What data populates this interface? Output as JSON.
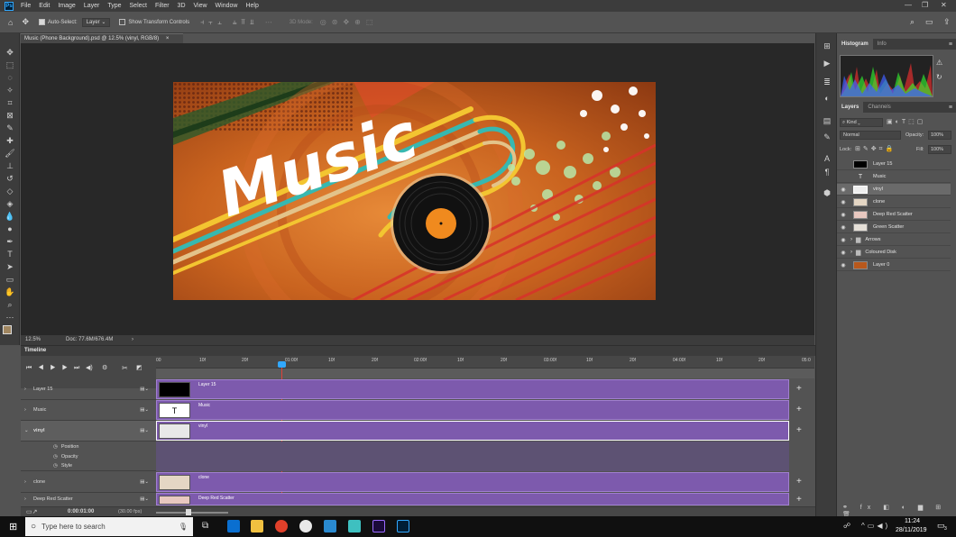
{
  "menubar": {
    "logo": "Ps",
    "items": [
      "File",
      "Edit",
      "Image",
      "Layer",
      "Type",
      "Select",
      "Filter",
      "3D",
      "View",
      "Window",
      "Help"
    ],
    "minimize": "—",
    "restore": "❐",
    "close": "✕"
  },
  "options": {
    "auto_select_label": "Auto-Select:",
    "auto_select_value": "Layer",
    "show_transform_label": "Show Transform Controls",
    "mode_3d": "3D Mode:"
  },
  "document": {
    "tab_title": "Music (Phone Background).psd @ 12.5% (vinyl, RGB/8)",
    "tab_close": "×",
    "art_title": "Music",
    "zoom": "12.5%",
    "doc_info": "Doc: 77.6M/676.4M"
  },
  "panels": {
    "histogram_tab": "Histogram",
    "info_tab": "Info",
    "layers_tab": "Layers",
    "channels_tab": "Channels",
    "kind_label": "Kind",
    "blend_mode": "Normal",
    "opacity_label": "Opacity:",
    "opacity_value": "100%",
    "lock_label": "Lock:",
    "fill_label": "Fill:",
    "fill_value": "100%",
    "layers": [
      {
        "name": "Layer 15",
        "visible": false,
        "type": "solid",
        "thumb": "#000000"
      },
      {
        "name": "Music",
        "visible": false,
        "type": "text"
      },
      {
        "name": "vinyl",
        "visible": true,
        "type": "image",
        "selected": true
      },
      {
        "name": "clone",
        "visible": true,
        "type": "image"
      },
      {
        "name": "Deep Red Scatter",
        "visible": true,
        "type": "image"
      },
      {
        "name": "Green Scatter",
        "visible": true,
        "type": "image"
      },
      {
        "name": "Arrows",
        "visible": true,
        "type": "group"
      },
      {
        "name": "Coloured Disk",
        "visible": true,
        "type": "group"
      },
      {
        "name": "Layer 0",
        "visible": true,
        "type": "image",
        "thumb": "#b8581c"
      }
    ]
  },
  "timeline": {
    "title": "Timeline",
    "ruler_labels": [
      "00",
      "10f",
      "20f",
      "01:00f",
      "10f",
      "20f",
      "02:00f",
      "10f",
      "20f",
      "03:00f",
      "10f",
      "20f",
      "04:00f",
      "10f",
      "20f",
      "05:0"
    ],
    "current_time": "0:00:01:00",
    "fps": "(30.00 fps)",
    "tracks": [
      {
        "name": "Layer 15",
        "clip": "Layer 15",
        "expanded": false
      },
      {
        "name": "Music",
        "clip": "Music",
        "expanded": false
      },
      {
        "name": "vinyl",
        "clip": "vinyl",
        "expanded": true
      },
      {
        "name": "clone",
        "clip": "clone",
        "expanded": false
      },
      {
        "name": "Deep Red Scatter",
        "clip": "Deep Red Scatter",
        "expanded": false
      }
    ],
    "sub_props": [
      "Position",
      "Opacity",
      "Style"
    ]
  },
  "taskbar": {
    "search_placeholder": "Type here to search",
    "time": "11:24",
    "date": "28/11/2019",
    "notifications": "3"
  },
  "colors": {
    "accent": "#31a8ff",
    "clip_purple": "#7d5aad",
    "playhead": "#e0413a"
  }
}
